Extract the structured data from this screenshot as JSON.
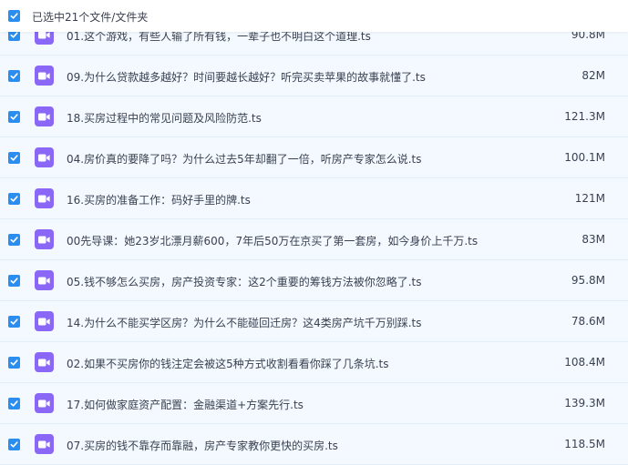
{
  "header": {
    "selection_text": "已选中21个文件/文件夹"
  },
  "files": [
    {
      "name": "01.这个游戏，有些人输了所有钱，一辈子也不明白这个道理.ts",
      "size": "90.8M"
    },
    {
      "name": "09.为什么贷款越多越好？时间要越长越好？听完买卖苹果的故事就懂了.ts",
      "size": "82M"
    },
    {
      "name": "18.买房过程中的常见问题及风险防范.ts",
      "size": "121.3M"
    },
    {
      "name": "04.房价真的要降了吗？为什么过去5年却翻了一倍，听房产专家怎么说.ts",
      "size": "100.1M"
    },
    {
      "name": "16.买房的准备工作：码好手里的牌.ts",
      "size": "121M"
    },
    {
      "name": "00先导课：她23岁北漂月薪600，7年后50万在京买了第一套房，如今身价上千万.ts",
      "size": "83M"
    },
    {
      "name": "05.钱不够怎么买房，房产投资专家：这2个重要的筹钱方法被你忽略了.ts",
      "size": "95.8M"
    },
    {
      "name": "14.为什么不能买学区房？为什么不能碰回迁房？这4类房产坑千万别踩.ts",
      "size": "78.6M"
    },
    {
      "name": "02.如果不买房你的钱注定会被这5种方式收割看看你踩了几条坑.ts",
      "size": "108.4M"
    },
    {
      "name": "17.如何做家庭资产配置：金融渠道+方案先行.ts",
      "size": "139.3M"
    },
    {
      "name": "07.买房的钱不靠存而靠融，房产专家教你更快的买房.ts",
      "size": "118.5M"
    }
  ]
}
